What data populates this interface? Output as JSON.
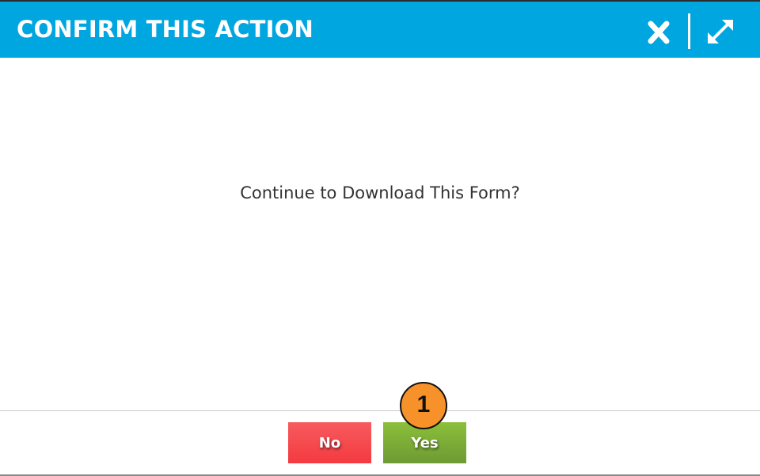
{
  "dialog": {
    "title": "CONFIRM THIS ACTION",
    "message": "Continue to Download This Form?",
    "buttons": {
      "no_label": "No",
      "yes_label": "Yes"
    },
    "icons": {
      "close": "close-icon",
      "expand": "expand-icon"
    },
    "colors": {
      "header": "#00a6df",
      "no": "#f43a40",
      "yes": "#7aab36",
      "marker": "#f7922a"
    }
  },
  "annotation": {
    "step_number": "1"
  }
}
